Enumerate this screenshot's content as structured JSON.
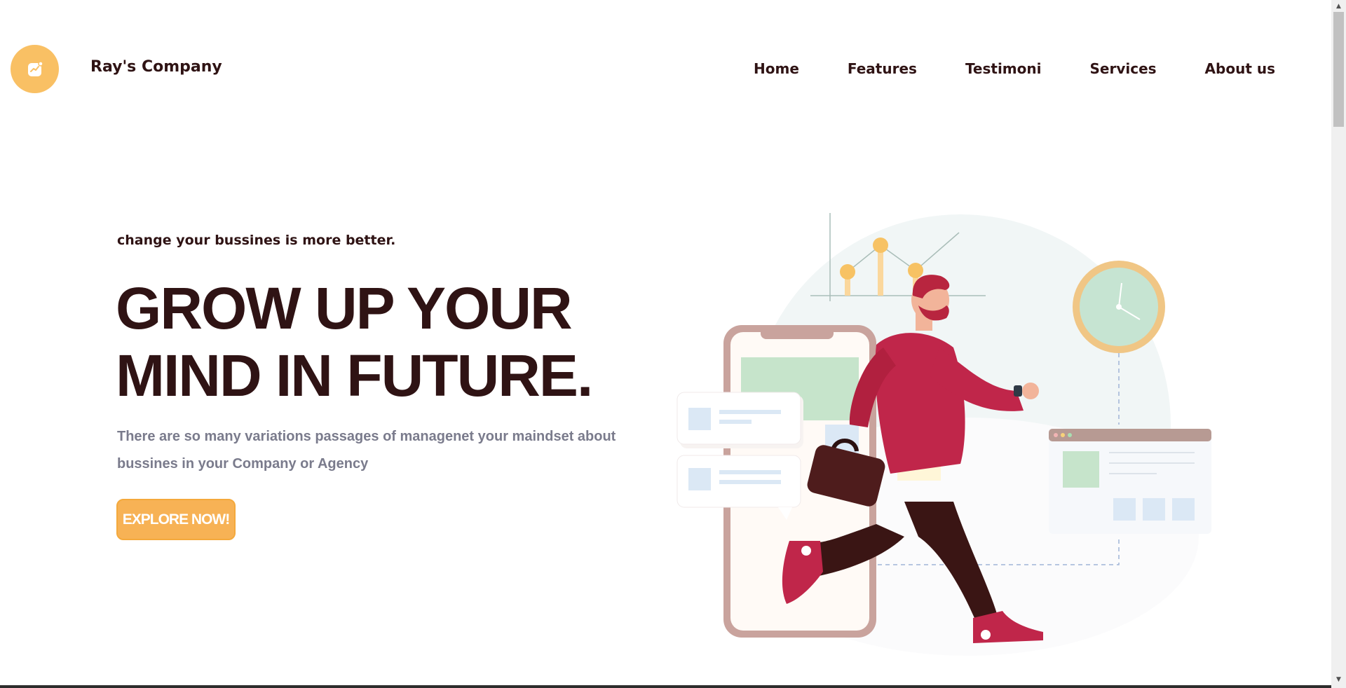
{
  "header": {
    "brand": "Ray's Company",
    "logo_icon": "chart-trend-icon",
    "nav": [
      {
        "label": "Home"
      },
      {
        "label": "Features"
      },
      {
        "label": "Testimoni"
      },
      {
        "label": "Services"
      },
      {
        "label": "About us"
      }
    ]
  },
  "hero": {
    "eyebrow": "change your bussines is more better.",
    "headline_line1": "GROW UP YOUR",
    "headline_line2": "MIND IN FUTURE.",
    "description": "There are so many variations passages of managenet your maindset about bussines in your Company or Agency",
    "cta_label": "EXPLORE NOW!"
  },
  "colors": {
    "accent": "#f9c064",
    "button": "#f7b255",
    "heading": "#2f1314",
    "muted": "#7a7b8c",
    "illustration_red": "#c0264a",
    "illustration_brown": "#3a1514"
  },
  "icons": [
    "chart-trend-icon",
    "scroll-up-arrow-icon",
    "scroll-down-arrow-icon"
  ]
}
